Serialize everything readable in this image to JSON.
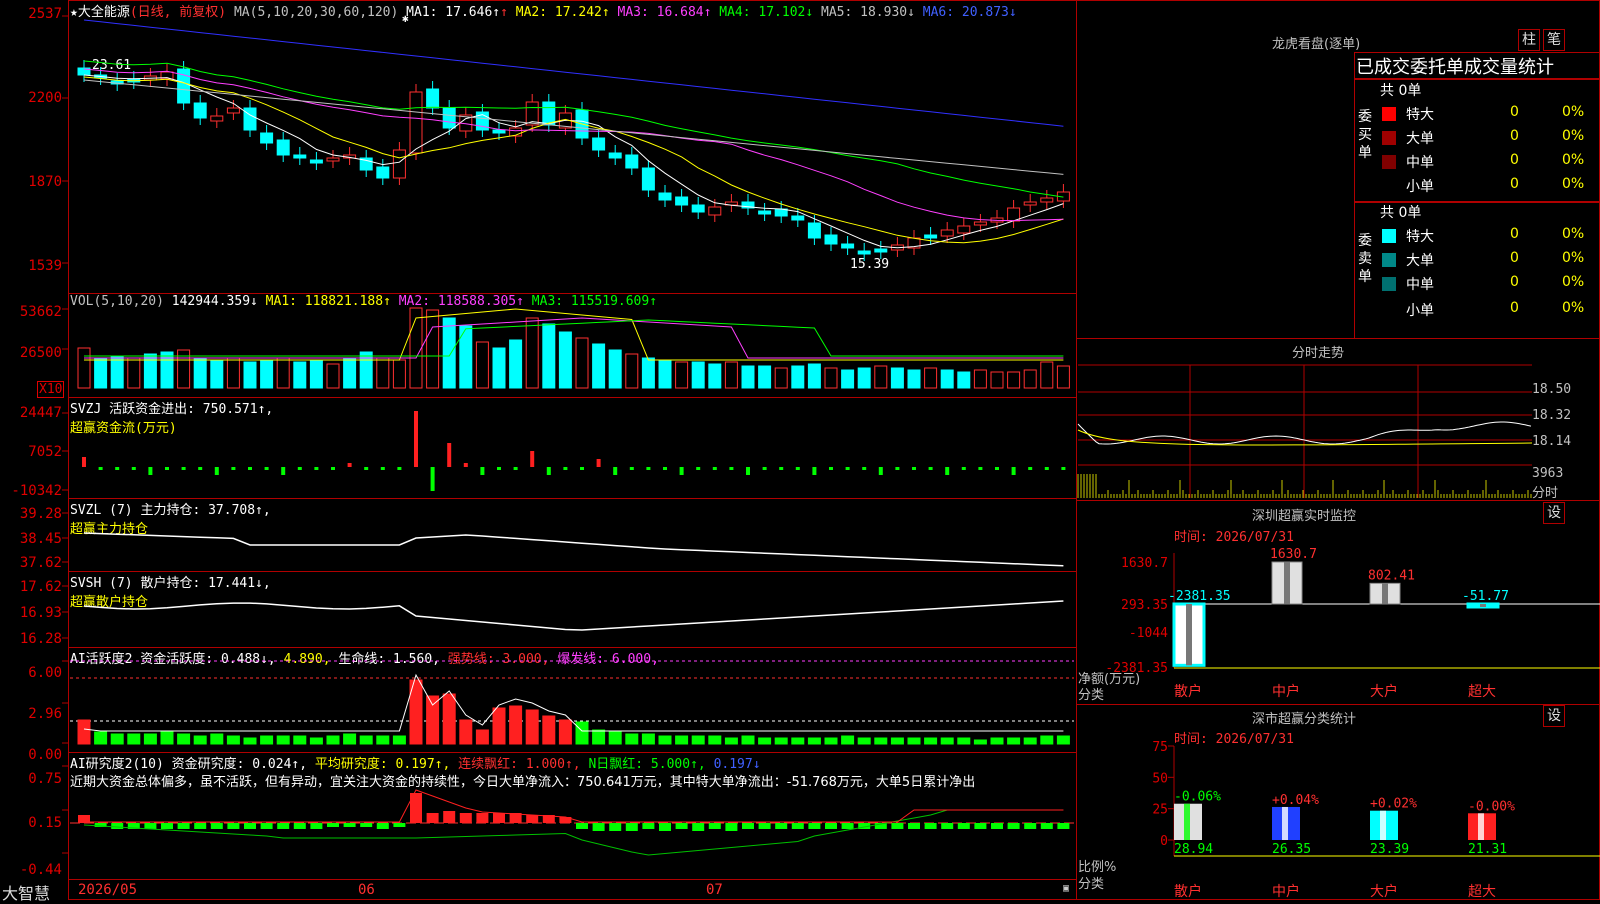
{
  "stock": {
    "name": "★大全能源",
    "period": "(日线, 前复权)",
    "ma_params": "MA(5,10,20,30,60,120)",
    "ma1": "MA1: 17.646↑",
    "ma2": "MA2: 17.242↑",
    "ma3": "MA3: 16.684↑",
    "ma4": "MA4: 17.102↓",
    "ma5": "MA5: 18.930↓",
    "ma6": "MA6: 20.873↓",
    "y_labels": [
      "2537",
      "2200",
      "1870",
      "1539"
    ],
    "high_marker": "23.61",
    "low_marker": "15.39",
    "star": "✱"
  },
  "vol": {
    "params": "VOL(5,10,20)",
    "value": "142944.359↓",
    "ma1": "MA1: 118821.188↑",
    "ma2": "MA2: 118588.305↑",
    "ma3": "MA3: 115519.609↑",
    "y_labels": [
      "53662",
      "26500"
    ],
    "unit": "X10"
  },
  "svzj": {
    "line1": "SVZJ  活跃资金进出: 750.571↑,",
    "line2": "超赢资金流(万元)",
    "y_labels": [
      "24447",
      "7052",
      "-10342"
    ]
  },
  "svzl": {
    "line1": "SVZL (7) 主力持仓: 37.708↑,",
    "line2": "超赢主力持仓",
    "y_labels": [
      "39.28",
      "38.45",
      "37.62"
    ]
  },
  "svsh": {
    "line1": "SVSH (7) 散户持仓: 17.441↓,",
    "line2": "超赢散户持仓",
    "y_labels": [
      "17.62",
      "16.93",
      "16.28"
    ]
  },
  "ai_active": {
    "title": "AI活跃度2 资金活跃度: 0.488↓,",
    "v2": "4.890,",
    "life": "生命线: 1.560,",
    "strong": "强势线: 3.000,",
    "burst": "爆发线: 6.000,",
    "y_labels": [
      "6.00",
      "2.96",
      "0.00"
    ]
  },
  "ai_research": {
    "title": "AI研究度2(10) 资金研究度: 0.024↑,",
    "avg": "平均研究度: 0.197↑,",
    "cont": "连续飘红: 1.000↑,",
    "nday": "N日飘红: 5.000↑,",
    "last": "0.197↓",
    "comment": "近期大资金总体偏多，虽不活跃，但有异动，宜关注大资金的持续性，今日大单净流入：750.641万元，其中特大单净流出：-51.768万元，大单5日累计净出",
    "y_labels": [
      "0.75",
      "0.15",
      "-0.44"
    ]
  },
  "x_axis": {
    "brand": "大智慧",
    "labels": [
      "2026/05",
      "06",
      "07"
    ]
  },
  "right": {
    "lhb_title": "龙虎看盘(逐单)",
    "btn_zhu": "柱",
    "btn_bi": "笔",
    "subtitle": "已成交委托单成交量统计",
    "buy": {
      "total": "共 0单",
      "side": "委买单",
      "rows": [
        {
          "label": "特大",
          "n": "0",
          "p": "0%"
        },
        {
          "label": "大单",
          "n": "0",
          "p": "0%"
        },
        {
          "label": "中单",
          "n": "0",
          "p": "0%"
        },
        {
          "label": "小单",
          "n": "0",
          "p": "0%"
        }
      ]
    },
    "sell": {
      "total": "共 0单",
      "side": "委卖单",
      "rows": [
        {
          "label": "特大",
          "n": "0",
          "p": "0%"
        },
        {
          "label": "大单",
          "n": "0",
          "p": "0%"
        },
        {
          "label": "中单",
          "n": "0",
          "p": "0%"
        },
        {
          "label": "小单",
          "n": "0",
          "p": "0%"
        }
      ]
    },
    "intraday_title": "分时走势",
    "intraday_labels": [
      "18.50",
      "18.32",
      "18.14",
      "3963",
      "分时"
    ],
    "monitor": {
      "title": "深圳超赢实时监控",
      "set": "设",
      "date": "时间: 2026/07/31",
      "y_labels": [
        "1630.7",
        "293.35",
        "-1044",
        "-2381.35"
      ],
      "bars": [
        {
          "label": "散户",
          "value": -2381.35,
          "text": "-2381.35"
        },
        {
          "label": "中户",
          "value": 1630.7,
          "text": "1630.7"
        },
        {
          "label": "大户",
          "value": 802.41,
          "text": "802.41"
        },
        {
          "label": "超大",
          "value": -51.77,
          "text": "-51.77"
        }
      ],
      "axis_name": "净额(万元)",
      "axis_cat": "分类"
    },
    "stats": {
      "title": "深市超赢分类统计",
      "set": "设",
      "date": "时间: 2026/07/31",
      "y_labels": [
        "75",
        "50",
        "25",
        "0"
      ],
      "bars": [
        {
          "label": "散户",
          "value": 28.94,
          "text": "28.94",
          "chg": "-0.06%"
        },
        {
          "label": "中户",
          "value": 26.35,
          "text": "26.35",
          "chg": "+0.04%"
        },
        {
          "label": "大户",
          "value": 23.39,
          "text": "23.39",
          "chg": "+0.02%"
        },
        {
          "label": "超大",
          "value": 21.31,
          "text": "21.31",
          "chg": "-0.00%"
        }
      ],
      "axis_name": "比例%",
      "axis_cat": "分类"
    }
  },
  "colors": {
    "up": "#ff3030",
    "down": "#00ffff",
    "frame": "#b00000",
    "green": "#00ff00"
  }
}
